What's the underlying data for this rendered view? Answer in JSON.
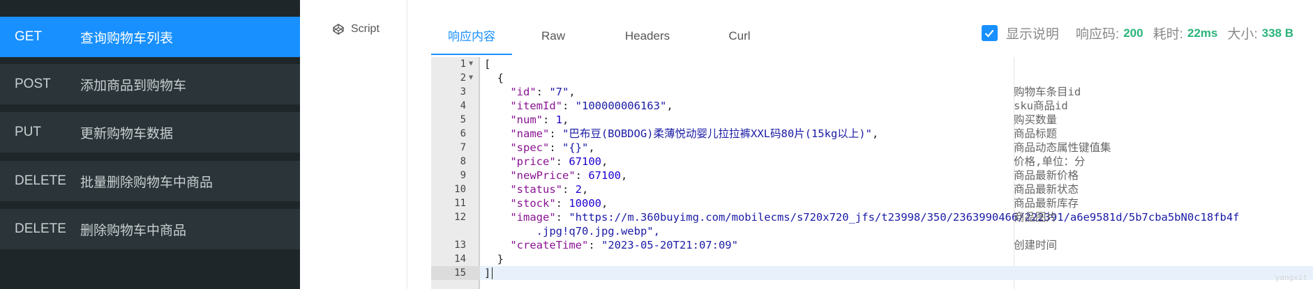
{
  "api_list": [
    {
      "method": "GET",
      "name": "查询购物车列表",
      "active": true
    },
    {
      "method": "POST",
      "name": "添加商品到购物车",
      "active": false
    },
    {
      "method": "PUT",
      "name": "更新购物车数据",
      "active": false
    },
    {
      "method": "DELETE",
      "name": "批量删除购物车中商品",
      "active": false
    },
    {
      "method": "DELETE",
      "name": "删除购物车中商品",
      "active": false
    }
  ],
  "script": {
    "label": "Script",
    "icon": "codepen-icon"
  },
  "tabs": [
    {
      "label": "响应内容",
      "active": true
    },
    {
      "label": "Raw",
      "active": false
    },
    {
      "label": "Headers",
      "active": false
    },
    {
      "label": "Curl",
      "active": false
    }
  ],
  "status": {
    "show_desc_label": "显示说明",
    "show_desc_checked": true,
    "code_label": "响应码:",
    "code_value": "200",
    "time_label": "耗时:",
    "time_value": "22ms",
    "size_label": "大小:",
    "size_value": "338 B"
  },
  "code_lines": [
    {
      "n": "1",
      "fold": true,
      "text": "[",
      "desc": ""
    },
    {
      "n": "2",
      "fold": true,
      "text": "  {",
      "desc": ""
    },
    {
      "n": "3",
      "key": "id",
      "val": "\"7\"",
      "type": "str",
      "comma": ",",
      "desc": "购物车条目id"
    },
    {
      "n": "4",
      "key": "itemId",
      "val": "\"100000006163\"",
      "type": "str",
      "comma": ",",
      "desc": "sku商品id"
    },
    {
      "n": "5",
      "key": "num",
      "val": "1",
      "type": "num",
      "comma": ",",
      "desc": "购买数量"
    },
    {
      "n": "6",
      "key": "name",
      "val": "\"巴布豆(BOBDOG)柔薄悦动婴儿拉拉裤XXL码80片(15kg以上)\"",
      "type": "str",
      "comma": ",",
      "desc": "商品标题"
    },
    {
      "n": "7",
      "key": "spec",
      "val": "\"{}\"",
      "type": "str",
      "comma": ",",
      "desc": "商品动态属性键值集"
    },
    {
      "n": "8",
      "key": "price",
      "val": "67100",
      "type": "num",
      "comma": ",",
      "desc": "价格,单位：分"
    },
    {
      "n": "9",
      "key": "newPrice",
      "val": "67100",
      "type": "num",
      "comma": ",",
      "desc": "商品最新价格"
    },
    {
      "n": "10",
      "key": "status",
      "val": "2",
      "type": "num",
      "comma": ",",
      "desc": "商品最新状态"
    },
    {
      "n": "11",
      "key": "stock",
      "val": "10000",
      "type": "num",
      "comma": ",",
      "desc": "商品最新库存"
    },
    {
      "n": "12",
      "key": "image",
      "val": "\"https://m.360buyimg.com/mobilecms/s720x720_jfs/t23998/350/2363990466/222391/a6e9581d/5b7cba5bN0c18fb4f",
      "type": "str",
      "comma": "",
      "desc": "商品图片",
      "wrap": ".jpg!q70.jpg.webp\","
    },
    {
      "n": "13",
      "key": "createTime",
      "val": "\"2023-05-20T21:07:09\"",
      "type": "str",
      "comma": "",
      "desc": "创建时间"
    },
    {
      "n": "14",
      "text": "  }",
      "desc": ""
    },
    {
      "n": "15",
      "text": "]",
      "desc": "",
      "current": true
    }
  ],
  "watermark": "yangxit"
}
